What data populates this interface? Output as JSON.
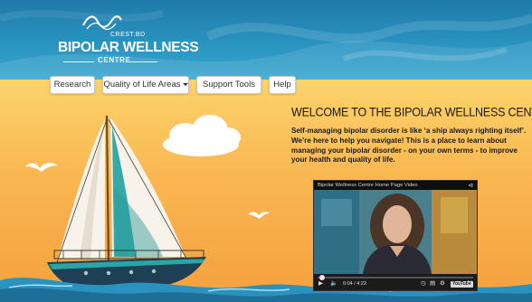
{
  "header": {
    "logo_mark_text": "CREST.BD",
    "logo_title": "BIPOLAR WELLNESS",
    "logo_subtitle": "CENTRE"
  },
  "nav": {
    "items": [
      {
        "label": "Research",
        "dropdown": false
      },
      {
        "label": "Quality of Life Areas",
        "dropdown": true
      },
      {
        "label": "Support Tools",
        "dropdown": false
      },
      {
        "label": "Help",
        "dropdown": false
      }
    ]
  },
  "main": {
    "heading": "WELCOME TO THE BIPOLAR WELLNESS CENTRE",
    "intro": "Self-managing bipolar disorder is like ‘a ship always righting itself’. We’re here to help you navigate! This is a place to learn about managing your bipolar disorder - on your own terms - to improve your health and quality of life."
  },
  "video": {
    "title": "Bipolar Wellness Centre Home Page Video",
    "time": "0:04 / 4:22",
    "progress": 0.02,
    "youtube_label": "YouTube"
  },
  "colors": {
    "header_blue": "#2a93c0",
    "sky_orange": "#f9b651",
    "sail_teal": "#2aa5a5",
    "hull_navy": "#1f3f55"
  }
}
